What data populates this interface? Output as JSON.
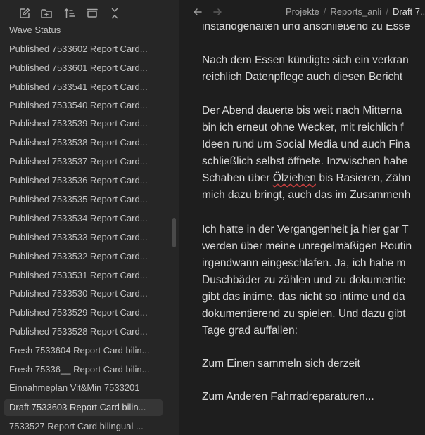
{
  "sidebar": {
    "toolbar": [
      {
        "name": "new-note-icon"
      },
      {
        "name": "new-folder-icon"
      },
      {
        "name": "sort-icon"
      },
      {
        "name": "collapse-panel-icon"
      },
      {
        "name": "collapse-all-icon"
      }
    ],
    "files": [
      {
        "label": "Wave Status"
      },
      {
        "label": "Published 7533602 Report Card..."
      },
      {
        "label": "Published 7533601 Report Card..."
      },
      {
        "label": "Published 7533541 Report Card..."
      },
      {
        "label": "Published 7533540 Report Card..."
      },
      {
        "label": "Published 7533539 Report Card..."
      },
      {
        "label": "Published 7533538 Report Card..."
      },
      {
        "label": "Published 7533537 Report Card..."
      },
      {
        "label": "Published 7533536 Report Card..."
      },
      {
        "label": "Published 7533535 Report Card..."
      },
      {
        "label": "Published 7533534 Report Card..."
      },
      {
        "label": "Published 7533533 Report Card..."
      },
      {
        "label": "Published 7533532 Report Card..."
      },
      {
        "label": "Published 7533531 Report Card..."
      },
      {
        "label": "Published 7533530 Report Card..."
      },
      {
        "label": "Published 7533529 Report Card..."
      },
      {
        "label": "Published 7533528 Report Card..."
      },
      {
        "label": "Fresh 7533604 Report Card bilin..."
      },
      {
        "label": "Fresh 75336__ Report Card bilin..."
      },
      {
        "label": "Einnahmeplan Vit&Min 7533201"
      },
      {
        "label": "Draft 7533603 Report Card bilin...",
        "active": true
      },
      {
        "label": "7533527 Report Card bilingual ..."
      }
    ]
  },
  "topbar": {
    "back_icon": "arrow-left-icon",
    "forward_icon": "arrow-right-icon",
    "breadcrumb": {
      "part1": "Projekte",
      "part2": "Reports_anli",
      "current": "Draft 7..."
    },
    "separator": "/"
  },
  "editor": {
    "lines": [
      {
        "text": "instandgehalten und anschließend zu Esse"
      },
      {
        "text": "Nach dem Essen kündigte sich ein verkran"
      },
      {
        "text": "reichlich Datenpflege auch diesen Bericht"
      },
      {
        "text": "Der Abend dauerte bis weit nach Mitterna"
      },
      {
        "text": "bin ich erneut ohne Wecker, mit reichlich f"
      },
      {
        "text": "Ideen rund um Social Media und auch Fina"
      },
      {
        "text": "schließlich selbst öffnete. Inzwischen habe"
      },
      {
        "pre": "Schaben über ",
        "spell": "Ölziehen",
        "post": " bis Rasieren, Zähn"
      },
      {
        "text": "mich dazu bringt, auch das im Zusammenh"
      },
      {
        "text": "Ich hatte in der Vergangenheit ja hier gar T"
      },
      {
        "text": "werden über meine unregelmäßigen Routin"
      },
      {
        "text": "irgendwann eingeschlafen. Ja, ich habe m"
      },
      {
        "text": "Duschbäder zu zählen und zu dokumentie"
      },
      {
        "text": "gibt das intime, das nicht so intime und da"
      },
      {
        "text": "dokumentierend zu spielen. Und dazu gibt"
      },
      {
        "text": "Tage grad auffallen:"
      },
      {
        "text": "Zum Einen sammeln sich derzeit"
      },
      {
        "text": "Zum Anderen Fahrradreparaturen..."
      }
    ]
  }
}
